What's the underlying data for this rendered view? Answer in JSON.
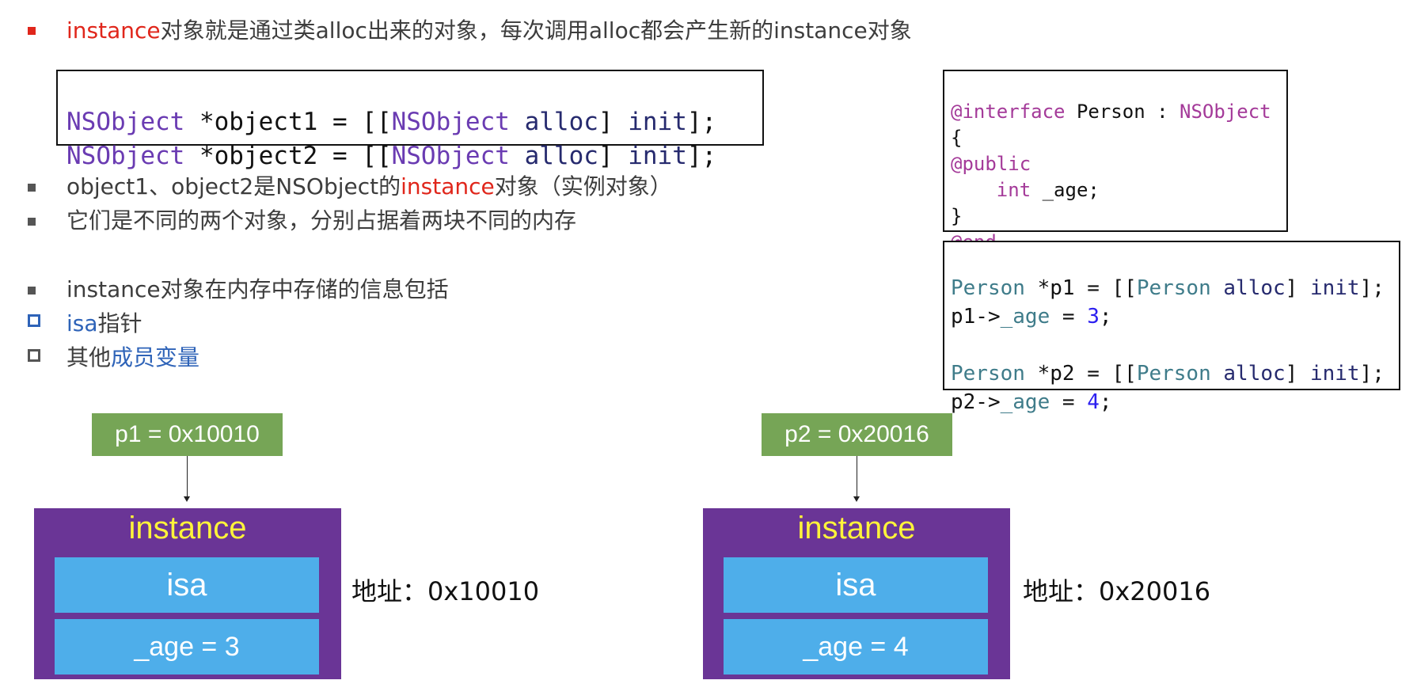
{
  "bullets": {
    "b1": {
      "prefix": "instance",
      "rest": "对象就是通过类alloc出来的对象，每次调用alloc都会产生新的instance对象"
    },
    "b2": {
      "a": "object1、object2是NSObject的",
      "hl": "instance",
      "b": "对象（实例对象）"
    },
    "b3": {
      "text": "它们是不同的两个对象，分别占据着两块不同的内存"
    },
    "b4": {
      "text": "instance对象在内存中存储的信息包括"
    },
    "b5": {
      "hl": "isa",
      "rest": "指针"
    },
    "b6": {
      "a": "其他",
      "hl": "成员变量"
    }
  },
  "code1": {
    "line1": {
      "cls": "NSObject",
      "var": " *object1 = [[",
      "cls2": "NSObject",
      "m1": " alloc",
      "sp": "] ",
      "m2": "init",
      "end": "];"
    },
    "line2": {
      "cls": "NSObject",
      "var": " *object2 = [[",
      "cls2": "NSObject",
      "m1": " alloc",
      "sp": "] ",
      "m2": "init",
      "end": "];"
    }
  },
  "code2": {
    "l1": {
      "kw": "@interface",
      "name": " Person : ",
      "sup": "NSObject"
    },
    "l2": "{",
    "l3": "@public",
    "l4": {
      "type": "    int",
      "var": " _age;"
    },
    "l5": "}",
    "l6": "@end"
  },
  "code3": {
    "l1": {
      "cls": "Person",
      "mid": " *p1 = [[",
      "cls2": "Person",
      "m1": " alloc",
      "sp": "] ",
      "m2": "init",
      "end": "];"
    },
    "l2": {
      "a": "p1->",
      "prop": "_age",
      "b": " = ",
      "num": "3",
      "c": ";"
    },
    "l3": {
      "cls": "Person",
      "mid": " *p2 = [[",
      "cls2": "Person",
      "m1": " alloc",
      "sp": "] ",
      "m2": "init",
      "end": "];"
    },
    "l4": {
      "a": "p2->",
      "prop": "_age",
      "b": " = ",
      "num": "4",
      "c": ";"
    }
  },
  "diagram": {
    "left": {
      "pointer": "p1 = 0x10010",
      "title": "instance",
      "isa": "isa",
      "field": "_age = 3",
      "addr": "地址：0x10010"
    },
    "right": {
      "pointer": "p2 = 0x20016",
      "title": "instance",
      "isa": "isa",
      "field": "_age = 4",
      "addr": "地址：0x20016"
    }
  },
  "colors": {
    "bullet_red": "#e0261b",
    "bullet_gray": "#555555",
    "pointer_green": "#76a556",
    "instance_purple": "#6a3596",
    "cell_blue": "#4eaeea",
    "instance_title_yellow": "#fff43a"
  }
}
